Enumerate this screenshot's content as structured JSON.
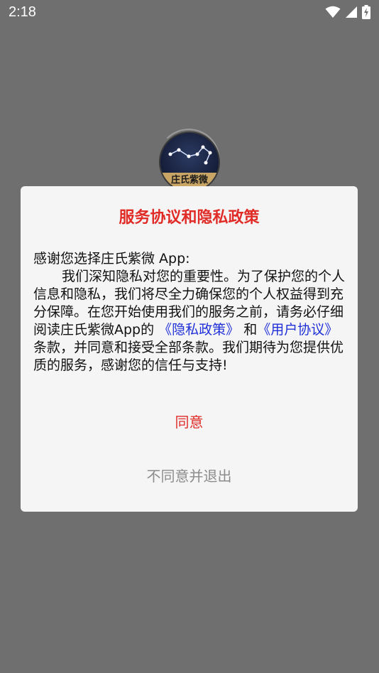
{
  "status_bar": {
    "time": "2:18",
    "icons": [
      "wifi-icon",
      "signal-icon",
      "battery-charging-icon"
    ]
  },
  "logo": {
    "text": "庄氏紫微"
  },
  "dialog": {
    "title": "服务协议和隐私政策",
    "greeting": "感谢您选择庄氏紫微 App:",
    "body_part1": "我们深知隐私对您的重要性。为了保护您的个人信息和隐私，我们将尽全力确保您的个人权益得到充分保障。在您开始使用我们的服务之前，请务必仔细阅读庄氏紫微App的 ",
    "privacy_link": "《隐私政策》",
    "body_and": " 和",
    "user_agreement_link": "《用户协议》",
    "body_part2": "条款，并同意和接受全部条款。我们期待为您提供优质的服务，感谢您的信任与支持!",
    "agree_label": "同意",
    "disagree_label": "不同意并退出"
  },
  "colors": {
    "overlay": "#6f6f6f",
    "dialog_bg": "#f5f5f5",
    "accent_red": "#e02b27",
    "link_blue": "#2030d8",
    "muted_gray": "#8c8c8c"
  }
}
